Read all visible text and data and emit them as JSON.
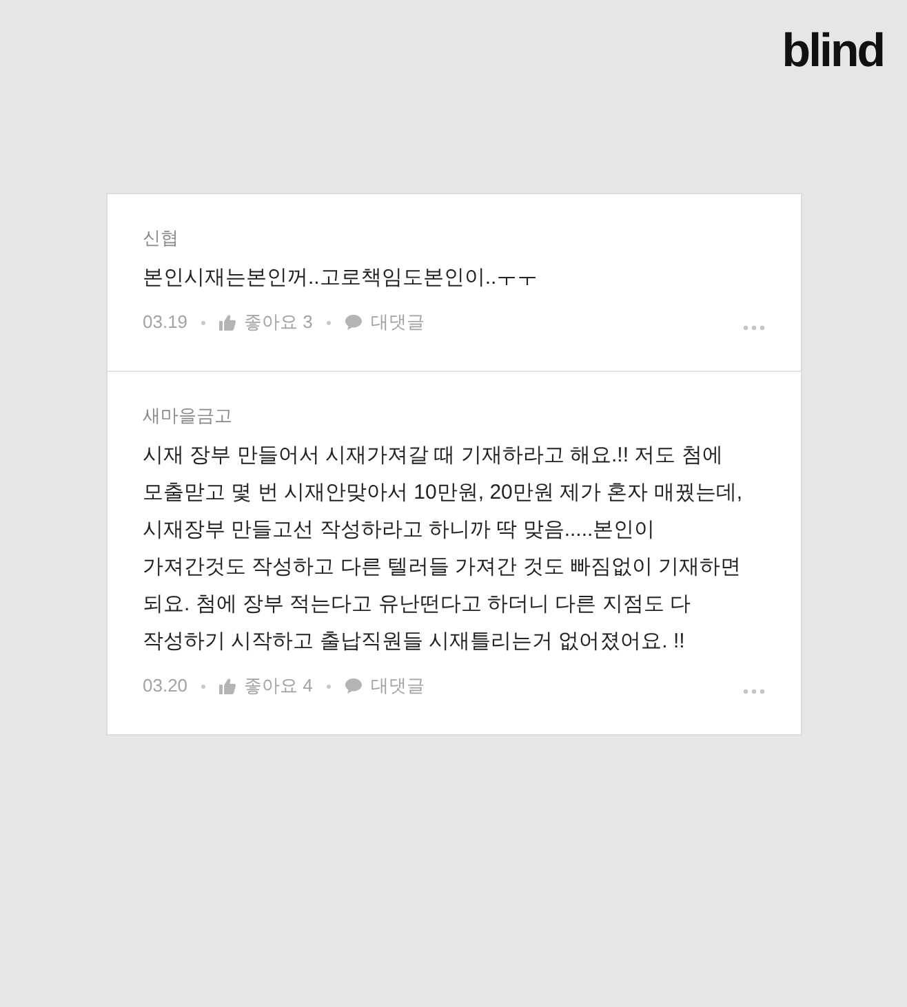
{
  "logo": {
    "text": "blind"
  },
  "comments": [
    {
      "author": "신협",
      "body": "본인시재는본인꺼..고로책임도본인이..ㅜㅜ",
      "date": "03.19",
      "likes": "좋아요 3",
      "reply": "대댓글"
    },
    {
      "author": "새마을금고",
      "body": "시재 장부 만들어서 시재가져갈 때 기재하라고 해요.!! 저도 첨에 모출맏고 몇 번 시재안맞아서 10만원, 20만원 제가 혼자 매꿨는데, 시재장부 만들고선 작성하라고 하니까 딱 맞음.....본인이 가져간것도 작성하고 다른 텔러들 가져간 것도 빠짐없이 기재하면 되요. 첨에 장부 적는다고 유난떤다고 하더니 다른 지점도 다 작성하기 시작하고 출납직원들 시재틀리는거 없어졌어요. !!",
      "date": "03.20",
      "likes": "좋아요 4",
      "reply": "대댓글"
    }
  ]
}
